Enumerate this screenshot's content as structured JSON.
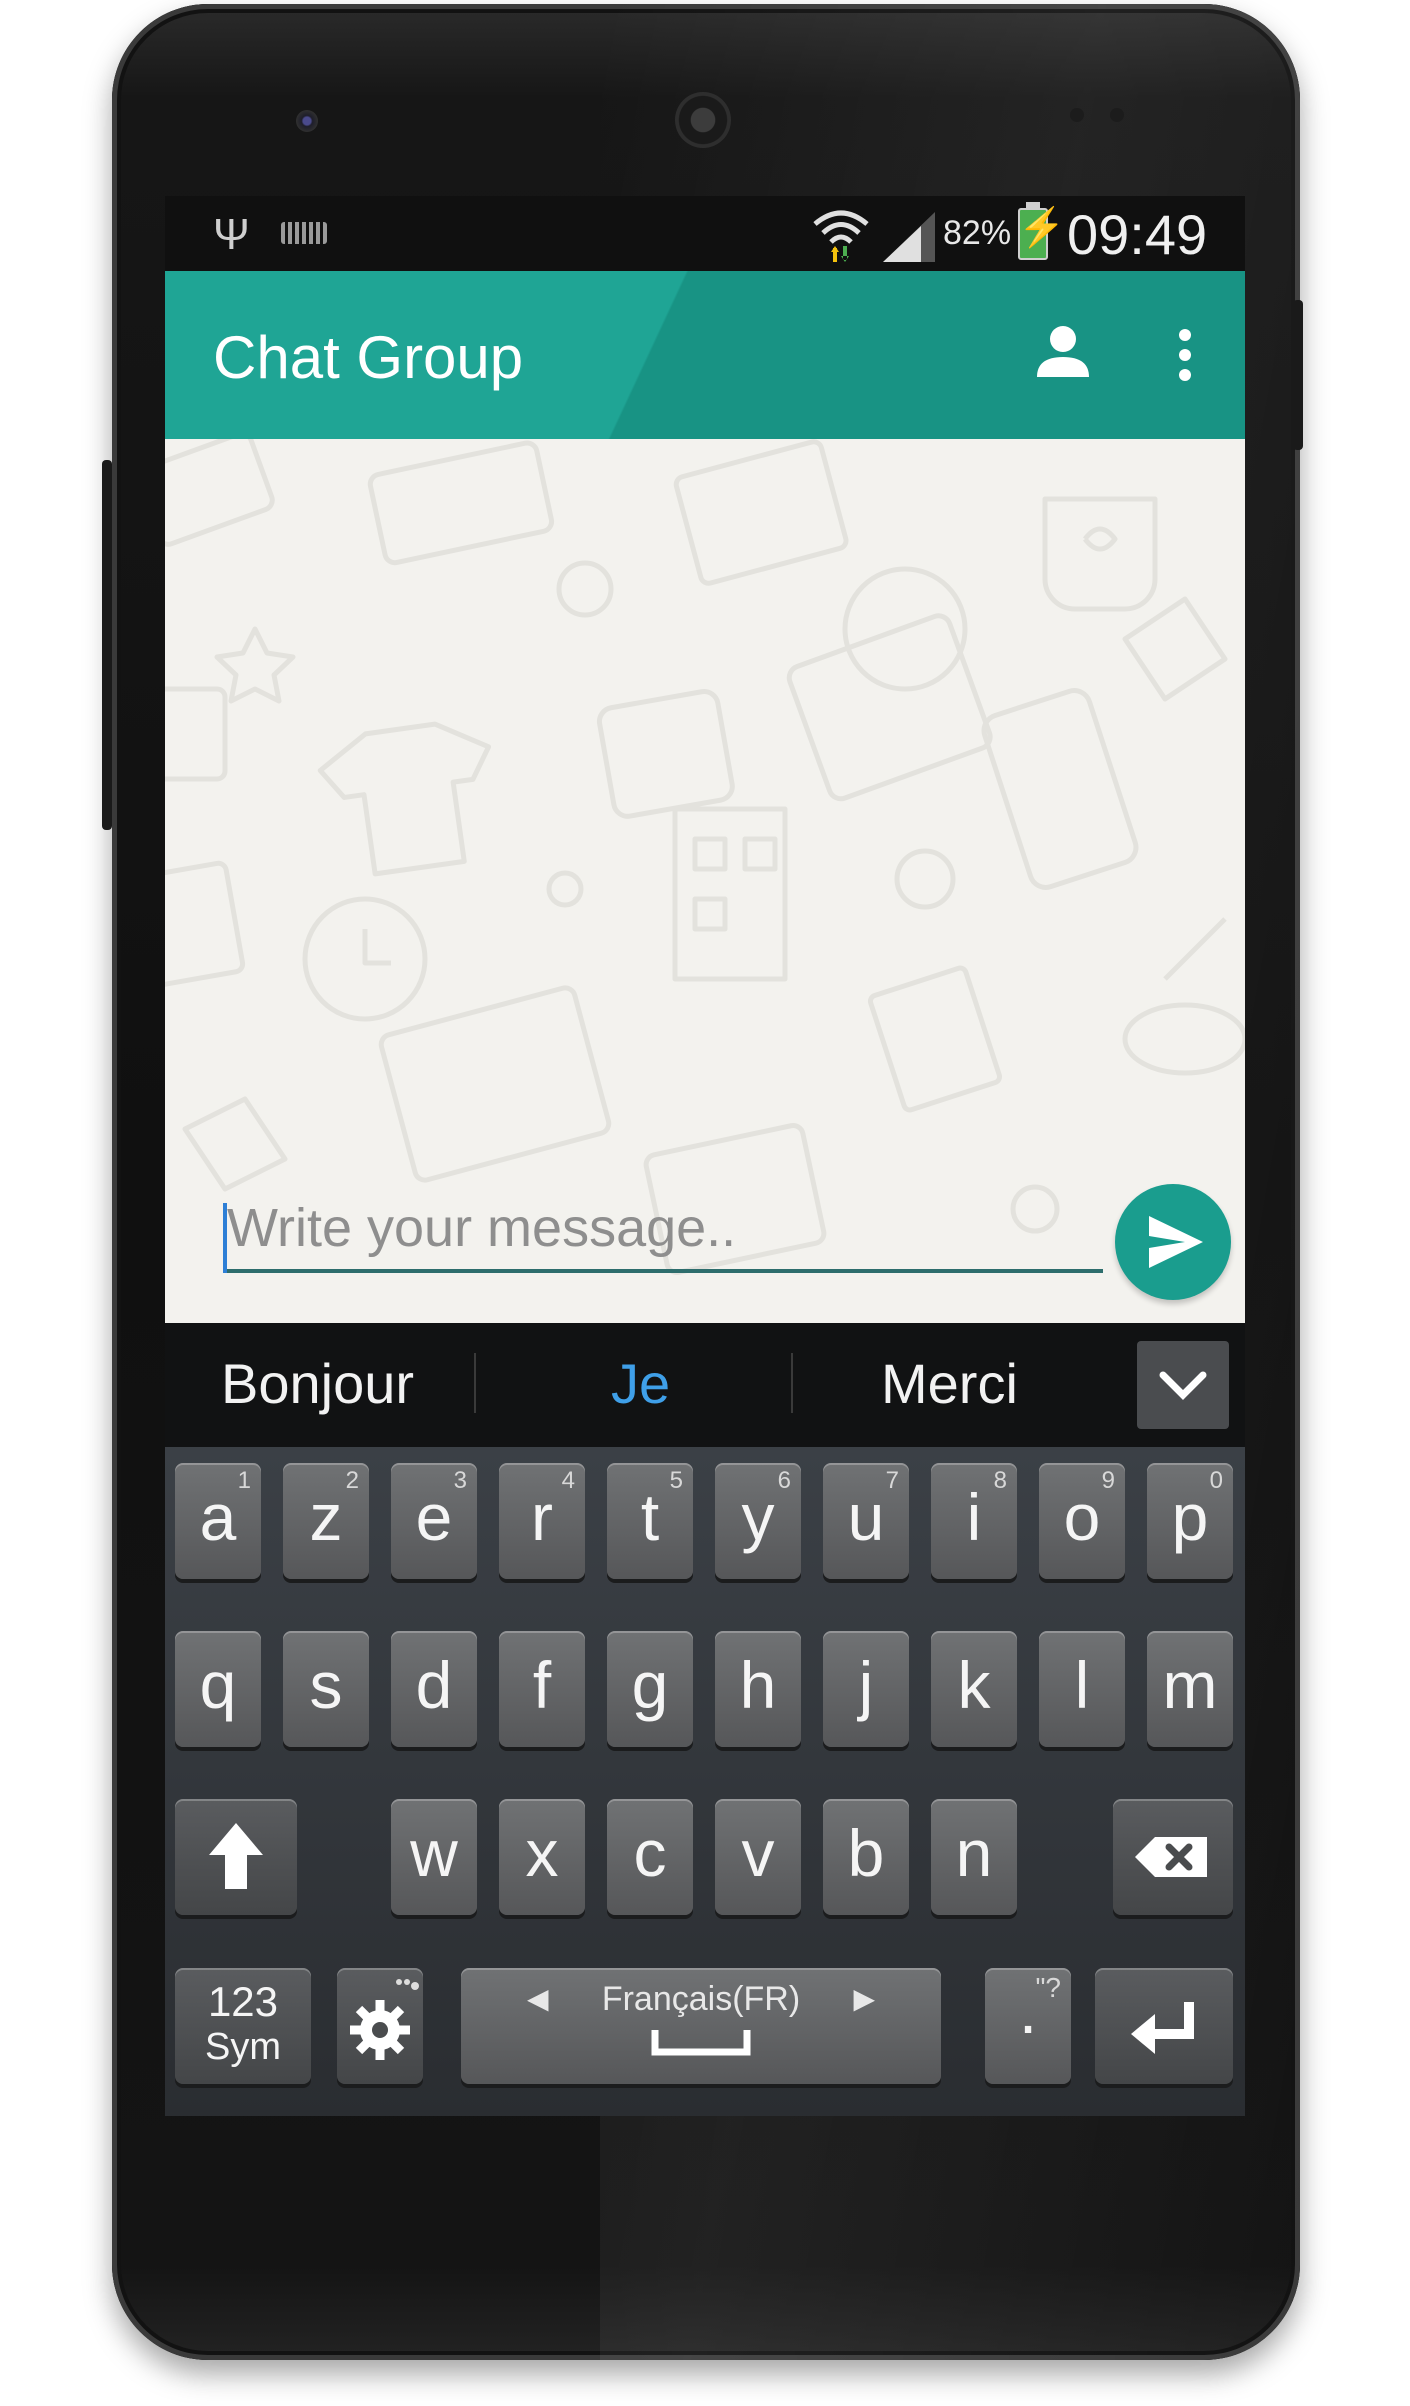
{
  "status_bar": {
    "battery_percent": "82%",
    "time": "09:49",
    "icons": [
      "usb-icon",
      "keyboard-icon",
      "wifi-icon",
      "signal-icon",
      "battery-charging-icon"
    ]
  },
  "toolbar": {
    "title": "Chat Group",
    "icons": [
      "person-icon",
      "more-vert-icon"
    ]
  },
  "composer": {
    "placeholder": "Write your message..",
    "send_icon": "send-icon"
  },
  "suggestions": {
    "words": [
      "Bonjour",
      "Je",
      "Merci"
    ],
    "highlighted_index": 1,
    "collapse_icon": "chevron-down-icon"
  },
  "keyboard": {
    "row1": [
      {
        "ch": "a",
        "num": "1"
      },
      {
        "ch": "z",
        "num": "2"
      },
      {
        "ch": "e",
        "num": "3"
      },
      {
        "ch": "r",
        "num": "4"
      },
      {
        "ch": "t",
        "num": "5"
      },
      {
        "ch": "y",
        "num": "6"
      },
      {
        "ch": "u",
        "num": "7"
      },
      {
        "ch": "i",
        "num": "8"
      },
      {
        "ch": "o",
        "num": "9"
      },
      {
        "ch": "p",
        "num": "0"
      }
    ],
    "row2": [
      "q",
      "s",
      "d",
      "f",
      "g",
      "h",
      "j",
      "k",
      "l",
      "m"
    ],
    "row3": [
      "w",
      "x",
      "c",
      "v",
      "b",
      "n"
    ],
    "sym_label_top": "123",
    "sym_label_bottom": "Sym",
    "space_label": "Français(FR)",
    "period": ".",
    "period_alt": "\"?",
    "icons": [
      "shift-icon",
      "backspace-icon",
      "settings-icon",
      "space-icon",
      "enter-icon"
    ]
  },
  "colors": {
    "accent": "#1a9d8e",
    "chat_background": "#f3f2ee",
    "suggestion_highlight": "#3f9fe8"
  }
}
